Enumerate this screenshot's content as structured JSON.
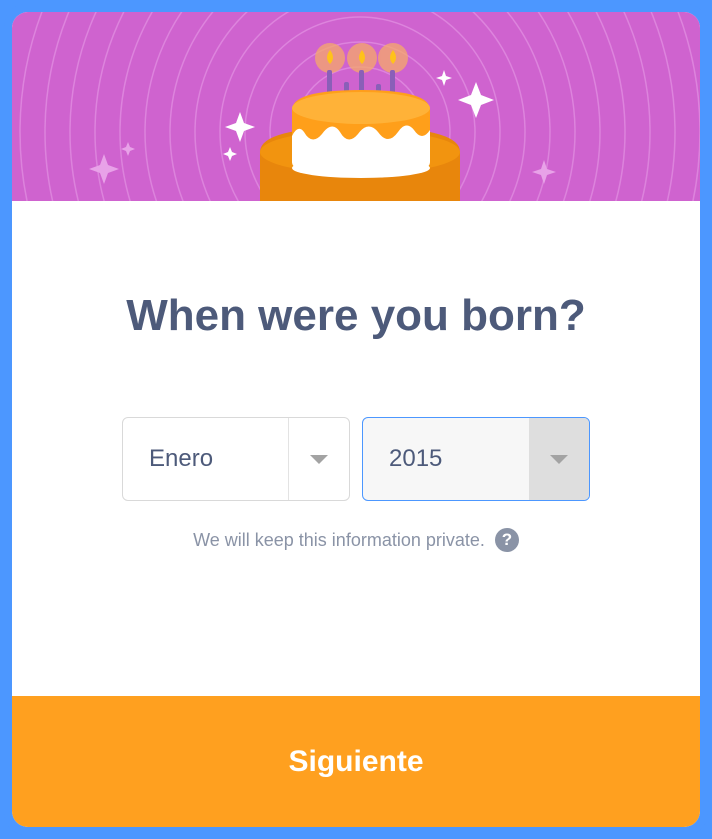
{
  "title": "When were you born?",
  "month_select": {
    "value": "Enero"
  },
  "year_select": {
    "value": "2015"
  },
  "privacy_note": "We will keep this information private.",
  "help_glyph": "?",
  "next_button": {
    "label": "Siguiente"
  },
  "colors": {
    "frame": "#4c97ff",
    "header": "#cf63cf",
    "cake": "#ff9f1a",
    "title_text": "#4d5a7a",
    "footer": "#ffa01f"
  },
  "icons": {
    "cake": "birthday-cake-icon",
    "dropdown": "caret-down-icon",
    "help": "question-mark-icon"
  }
}
